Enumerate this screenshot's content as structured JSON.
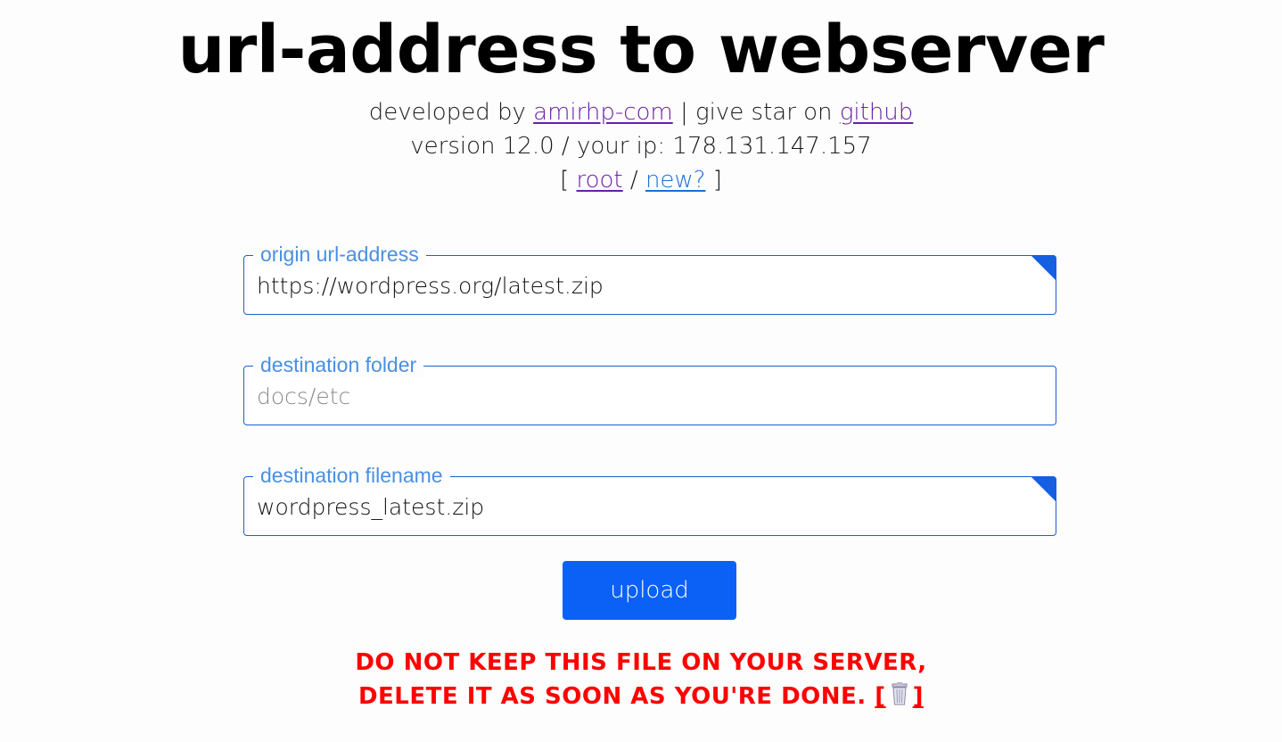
{
  "header": {
    "title": "url-address to webserver",
    "developed_prefix": "developed by",
    "developer_link": "amirhp-com",
    "separator": "|",
    "star_text": "give star on",
    "github_link": "github",
    "version_line": "version 12.0 / your ip: 178.131.147.157",
    "nav_open": "[",
    "root_link": "root",
    "nav_sep": "/",
    "new_link": "new?",
    "nav_close": "]"
  },
  "form": {
    "origin": {
      "label": "origin url-address",
      "value": "https://wordpress.org/latest.zip"
    },
    "folder": {
      "label": "destination folder",
      "placeholder": "docs/etc",
      "value": ""
    },
    "filename": {
      "label": "destination filename",
      "value": "wordpress_latest.zip"
    },
    "submit_label": "upload"
  },
  "warning": {
    "line1": "DO NOT KEEP THIS FILE ON YOUR SERVER,",
    "line2": "DELETE IT AS SOON AS YOU'RE DONE.",
    "delete_open": "[",
    "delete_close": "]",
    "delete_icon": "trash-icon"
  },
  "colors": {
    "accent": "#0b61f5",
    "label": "#4a8fe2",
    "warning": "#ff0000",
    "visited_link": "#6a1fa6",
    "link": "#1a6fdb"
  }
}
